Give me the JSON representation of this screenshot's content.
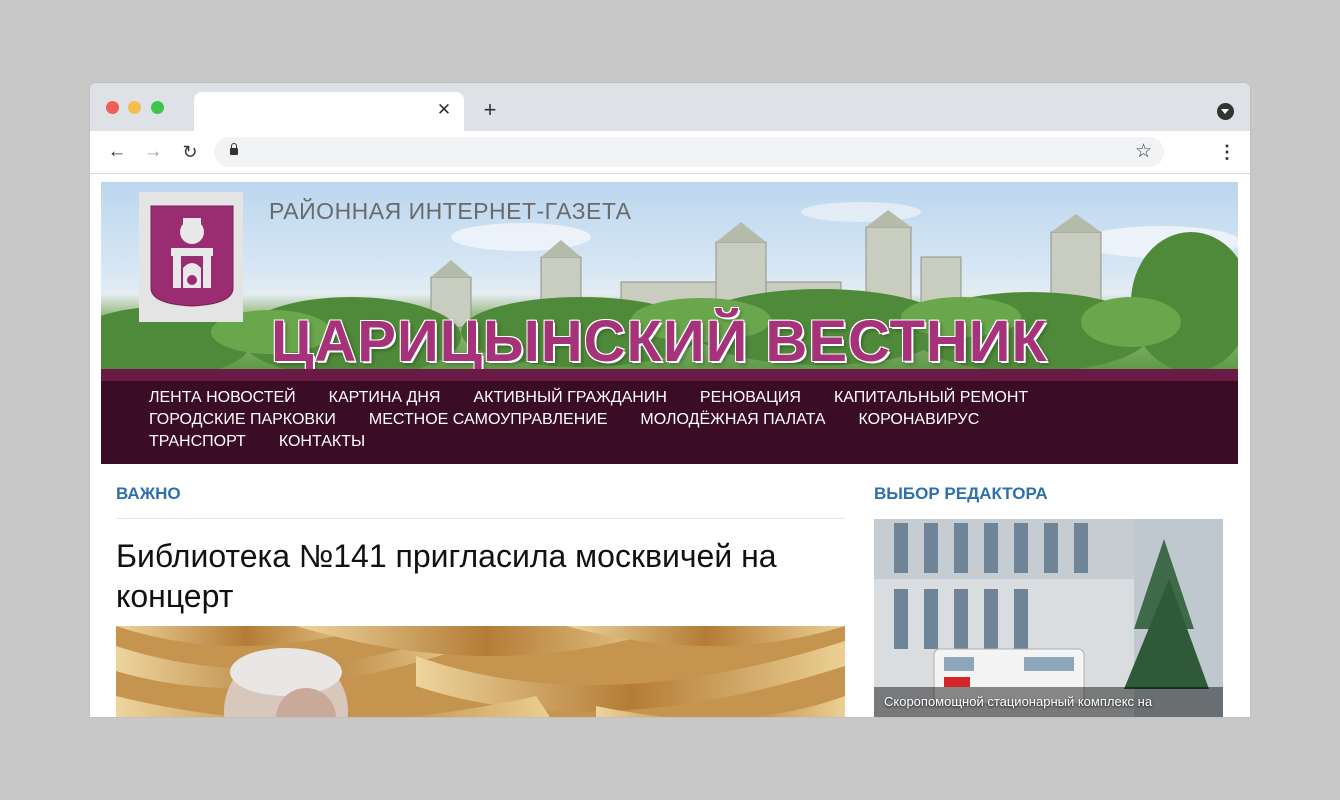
{
  "browser": {
    "tab_title": "",
    "url": "",
    "colors": {
      "tabstrip": "#dee1e6",
      "toolbar": "#ffffff",
      "omnibox": "#f1f3f4"
    }
  },
  "site": {
    "subtitle": "РАЙОННАЯ ИНТЕРНЕТ-ГАЗЕТА",
    "title": "ЦАРИЦЫНСКИЙ ВЕСТНИК",
    "colors": {
      "brand": "#a6327a",
      "menu_bg": "#3b0c25",
      "accent_blue": "#2f6fad"
    }
  },
  "nav": {
    "items": [
      "ЛЕНТА НОВОСТЕЙ",
      "КАРТИНА ДНЯ",
      "АКТИВНЫЙ ГРАЖДАНИН",
      "РЕНОВАЦИЯ",
      "КАПИТАЛЬНЫЙ РЕМОНТ",
      "ГОРОДСКИЕ ПАРКОВКИ",
      "МЕСТНОЕ САМОУПРАВЛЕНИЕ",
      "МОЛОДЁЖНАЯ ПАЛАТА",
      "КОРОНАВИРУС",
      "ТРАНСПОРТ",
      "КОНТАКТЫ"
    ]
  },
  "main": {
    "section_label": "ВАЖНО",
    "headline": "Библиотека №141 пригласила москвичей на концерт"
  },
  "sidebar": {
    "section_label": "ВЫБОР РЕДАКТОРА",
    "card_caption": "Скоропомощной стационарный комплекс на"
  },
  "icons": {
    "back": "arrow-left-icon",
    "forward": "arrow-right-icon",
    "reload": "reload-icon",
    "lock": "lock-icon",
    "star": "star-icon",
    "menu": "kebab-menu-icon",
    "close": "close-icon",
    "new_tab": "plus-icon"
  }
}
